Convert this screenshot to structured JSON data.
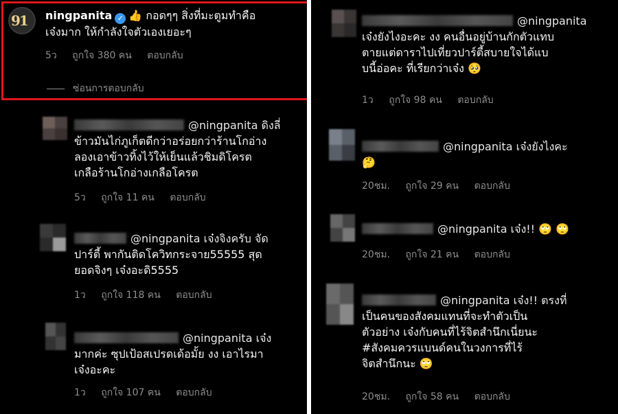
{
  "left_column": {
    "owner_comment": {
      "username": "ningpanita",
      "verified_icon": "verified-badge-icon",
      "emoji": "👍",
      "text_line1": "กอดๆๆ สิ่งที่มะตูมทำคือ",
      "text_line2": "เจ๋งมาก ให้กำลังใจตัวเองเยอะๆ",
      "time": "5ว",
      "likes": "ถูกใจ 380 คน",
      "reply": "ตอบกลับ",
      "hide_replies": "ซ่อนการตอบกลับ"
    },
    "replies": [
      {
        "line1": "@ningpanita ดิงลี่",
        "line2": "ข้าวมันไก่ภูเก็ตดีกว่าอร่อยกว่าร้านโกอ่าง",
        "line3": "ลองเอาข้าวทิ้งไว้ให้เย็นแล้วชิมดิโครต",
        "line4": "เกลือร้านโกอ่างเกลือโครต",
        "time": "5ว",
        "likes": "ถูกใจ 11 คน",
        "reply": "ตอบกลับ"
      },
      {
        "line1": "@ningpanita เจ๋งจิงครับ จัด",
        "line2": "ปาร์ตี้ พากันติดโควิทกระจาย55555 สุด",
        "line3": "ยอดจิงๆ เจ๋งอะดิ5555",
        "time": "1ว",
        "likes": "ถูกใจ 118 คน",
        "reply": "ตอบกลับ"
      },
      {
        "line1": "@ningpanita เจ๋ง",
        "line2": "มากค่ะ ซุปเป้อสเปรดเด้อมั้ย งง เอาไรมา",
        "line3": "เจ๋งอะคะ",
        "time": "1ว",
        "likes": "ถูกใจ 107 คน",
        "reply": "ตอบกลับ"
      }
    ]
  },
  "right_column": {
    "replies": [
      {
        "line1": "@ningpanita",
        "line2": "เจ๋งยังไงอะคะ งง คนอื่นอยู่บ้านกักตัวแทบ",
        "line3": "ตายแต่ดาราไปเที่ยวปาร์ตี้สบายใจได้แบ",
        "line4": "บนี้อ่อคะ ที่เรียกว่าเจ๋ง",
        "emoji": "🥺",
        "time": "1ว",
        "likes": "ถูกใจ 98 คน",
        "reply": "ตอบกลับ"
      },
      {
        "line1": "@ningpanita เจ๋งยังไงคะ",
        "emoji": "🤔",
        "time": "20ชม.",
        "likes": "ถูกใจ 29 คน",
        "reply": "ตอบกลับ"
      },
      {
        "line1": "@ningpanita เจ๋ง!!",
        "emoji": "🙄 🙄",
        "time": "20ชม.",
        "likes": "ถูกใจ 21 คน",
        "reply": "ตอบกลับ"
      },
      {
        "line1": "@ningpanita เจ๋ง!! ตรงที่",
        "line2": "เป็นคนของสังคมแทนที่จะทำตัวเป็น",
        "line3": "ตัวอย่าง เจ๋งกับคนที่ไร้จิตสำนึกเนี่ยนะ",
        "line4": "#สังคมควรแบนด์คนในวงการที่ไร้",
        "line5": "จิตสำนึกนะ",
        "emoji": "🙄",
        "time": "20ชม.",
        "likes": "ถูกใจ 58 คน",
        "reply": "ตอบกลับ"
      }
    ]
  },
  "colors": {
    "highlight_border": "#e1161c",
    "meta_text": "#8e8e8e",
    "background": "#000000",
    "verified": "#3897f0"
  }
}
